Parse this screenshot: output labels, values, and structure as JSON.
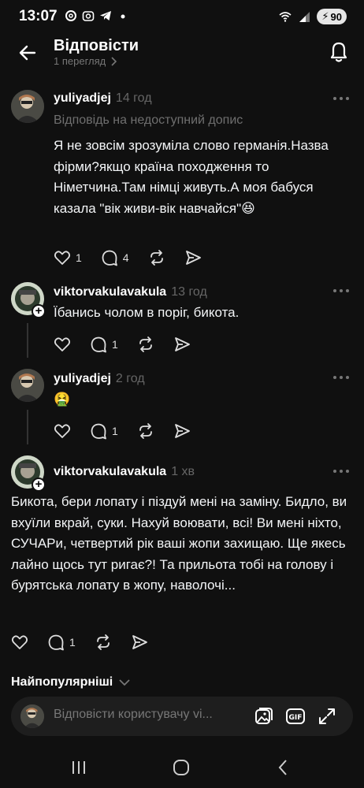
{
  "status_bar": {
    "time": "13:07",
    "battery": "90"
  },
  "header": {
    "title": "Відповісти",
    "views": "1 перегляд"
  },
  "posts": [
    {
      "username": "yuliyadjej",
      "time": "14 год",
      "reply_note": "Відповідь на недоступний допис",
      "text": "Я не зовсім зрозуміла слово германія.Назва фірми?якщо країна походження то Німетчина.Там німці живуть.А моя бабуся казала \"вік живи-вік навчайся\"😆",
      "likes": "1",
      "replies": "4"
    },
    {
      "username": "viktorvakulavakula",
      "time": "13 год",
      "text": "Їбанись чолом в поріг, бикота.",
      "likes": "",
      "replies": "1"
    },
    {
      "username": "yuliyadjej",
      "time": "2 год",
      "text": "🤮",
      "likes": "",
      "replies": "1"
    },
    {
      "username": "viktorvakulavakula",
      "time": "1 хв",
      "text": "Бикота, бери лопату і піздуй мені на заміну. Бидло, ви вхуїли вкрай, суки. Нахуй воювати, всі! Ви мені ніхто, СУЧАРи, четвертий рік ваші жопи захищаю. Ще якесь лайно щось тут ригає?! Та прильота тобі на голову і бурятська лопату в жопу, наволочі...",
      "likes": "",
      "replies": "1"
    }
  ],
  "sort_label": "Найпопулярніші",
  "composer": {
    "placeholder": "Відповісти користувачу vi..."
  }
}
